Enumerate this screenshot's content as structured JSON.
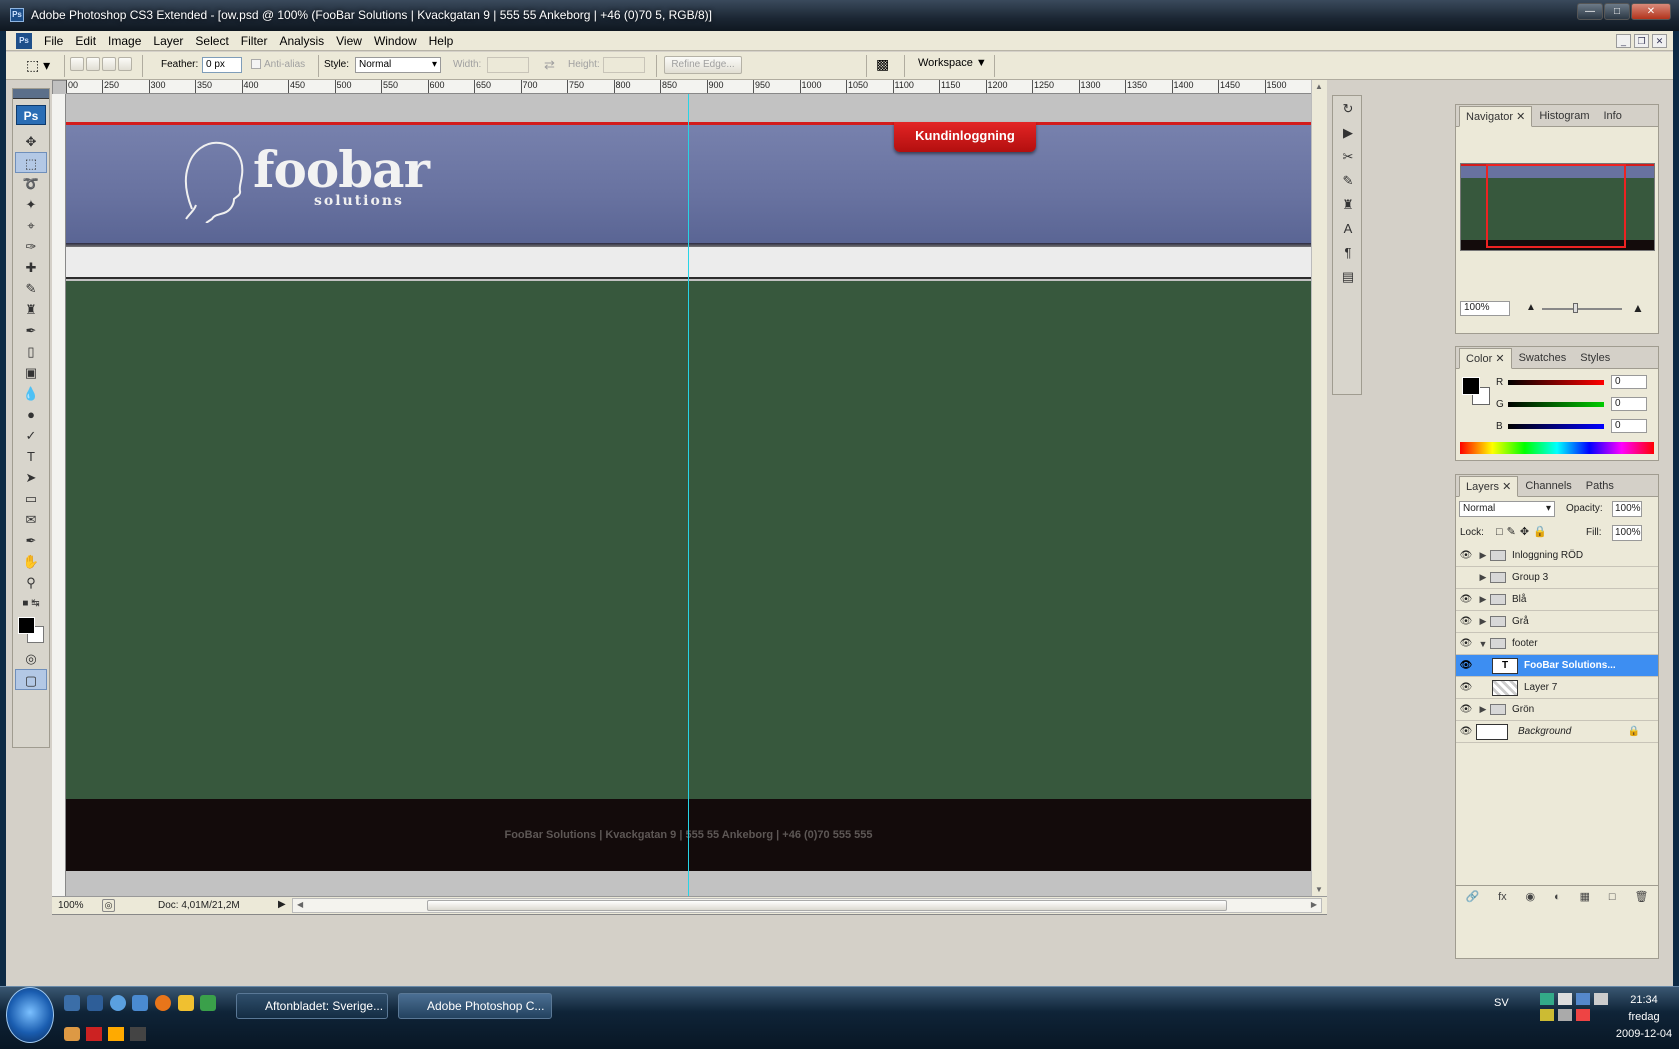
{
  "window": {
    "title": "Adobe Photoshop CS3 Extended - [ow.psd @ 100% (FooBar Solutions | Kvackgatan 9 | 555 55 Ankeborg | +46 (0)70 5, RGB/8)]"
  },
  "menu": [
    "File",
    "Edit",
    "Image",
    "Layer",
    "Select",
    "Filter",
    "Analysis",
    "View",
    "Window",
    "Help"
  ],
  "options": {
    "feather_label": "Feather:",
    "feather_value": "0 px",
    "antialias": "Anti-alias",
    "style_label": "Style:",
    "style_value": "Normal",
    "width_label": "Width:",
    "height_label": "Height:",
    "refine": "Refine Edge...",
    "workspace": "Workspace"
  },
  "ruler_ticks": [
    "00",
    "250",
    "300",
    "350",
    "400",
    "450",
    "500",
    "550",
    "600",
    "650",
    "700",
    "750",
    "800",
    "850",
    "900",
    "950",
    "1000",
    "1050",
    "1100",
    "1150",
    "1200",
    "1250",
    "1300",
    "1350",
    "1400",
    "1450",
    "1500"
  ],
  "canvas": {
    "logo_word": "foobar",
    "logo_sub": "solutions",
    "login_button": "Kundinloggning",
    "footer_text": "FooBar Solutions | Kvackgatan 9 | 555 55 Ankeborg | +46 (0)70 555 555"
  },
  "status": {
    "zoom": "100%",
    "doc": "Doc: 4,01M/21,2M"
  },
  "navigator": {
    "tabs": [
      "Navigator",
      "Histogram",
      "Info"
    ],
    "zoom": "100%"
  },
  "color": {
    "tabs": [
      "Color",
      "Swatches",
      "Styles"
    ],
    "r_label": "R",
    "g_label": "G",
    "b_label": "B",
    "r": "0",
    "g": "0",
    "b": "0"
  },
  "layers_panel": {
    "tabs": [
      "Layers",
      "Channels",
      "Paths"
    ],
    "blend": "Normal",
    "opacity_label": "Opacity:",
    "opacity": "100%",
    "lock_label": "Lock:",
    "fill_label": "Fill:",
    "fill": "100%",
    "items": [
      {
        "name": "Inloggning RÖD",
        "visible": true,
        "type": "group"
      },
      {
        "name": "Group 3",
        "visible": false,
        "type": "group"
      },
      {
        "name": "Blå",
        "visible": true,
        "type": "group"
      },
      {
        "name": "Grå",
        "visible": true,
        "type": "group"
      },
      {
        "name": "footer",
        "visible": true,
        "type": "group-open"
      },
      {
        "name": "FooBar Solutions...",
        "visible": true,
        "type": "text",
        "selected": true
      },
      {
        "name": "Layer 7",
        "visible": true,
        "type": "pixel"
      },
      {
        "name": "Grön",
        "visible": true,
        "type": "group"
      },
      {
        "name": "Background",
        "visible": true,
        "type": "background"
      }
    ]
  },
  "taskbar": {
    "tasks": [
      "Aftonbladet: Sverige...",
      "Adobe Photoshop C..."
    ],
    "lang": "SV",
    "time": "21:34",
    "day": "fredag",
    "date": "2009-12-04"
  },
  "colors": {
    "header": "#6872a0",
    "green": "#37583d",
    "footer": "#130b0b",
    "accent_red": "#d31c1c",
    "guide": "#27d3e6"
  }
}
